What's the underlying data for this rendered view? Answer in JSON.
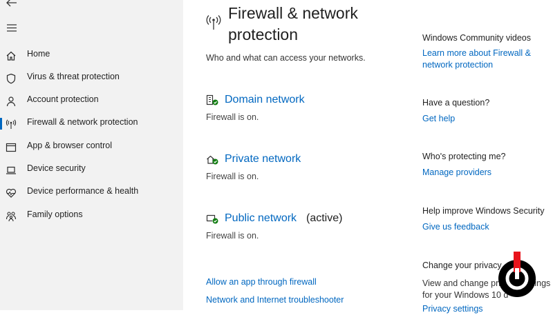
{
  "sidebar": {
    "items": [
      {
        "label": "Home",
        "icon": "home-icon"
      },
      {
        "label": "Virus & threat protection",
        "icon": "shield-icon"
      },
      {
        "label": "Account protection",
        "icon": "person-icon"
      },
      {
        "label": "Firewall & network protection",
        "icon": "antenna-icon",
        "active": true
      },
      {
        "label": "App & browser control",
        "icon": "browser-window-icon"
      },
      {
        "label": "Device security",
        "icon": "laptop-icon"
      },
      {
        "label": "Device performance & health",
        "icon": "heart-pulse-icon"
      },
      {
        "label": "Family options",
        "icon": "family-icon"
      }
    ]
  },
  "main": {
    "title": "Firewall & network protection",
    "subtitle": "Who and what can access your networks.",
    "networks": [
      {
        "name": "Domain network",
        "status": "Firewall is on.",
        "icon": "domain-network-icon"
      },
      {
        "name": "Private network",
        "status": "Firewall is on.",
        "icon": "private-network-icon"
      },
      {
        "name": "Public network",
        "active_label": "(active)",
        "status": "Firewall is on.",
        "icon": "public-network-icon"
      }
    ],
    "links": {
      "allow_app": "Allow an app through firewall",
      "troubleshooter": "Network and Internet troubleshooter"
    }
  },
  "right_panel": {
    "community": {
      "heading": "Windows Community videos",
      "link": "Learn more about Firewall & network protection"
    },
    "question": {
      "heading": "Have a question?",
      "link": "Get help"
    },
    "protecting": {
      "heading": "Who's protecting me?",
      "link": "Manage providers"
    },
    "improve": {
      "heading": "Help improve Windows Security",
      "link": "Give us feedback"
    },
    "privacy": {
      "heading": "Change your privacy",
      "text_line1": "View and change privacy settings",
      "text_line2": "for your Windows 10 d",
      "link": "Privacy settings"
    }
  },
  "colors": {
    "accent": "#0067c0",
    "sidebar_bg": "#f2f2f2",
    "check_green": "#107c10",
    "logo_red": "#e8141c"
  }
}
